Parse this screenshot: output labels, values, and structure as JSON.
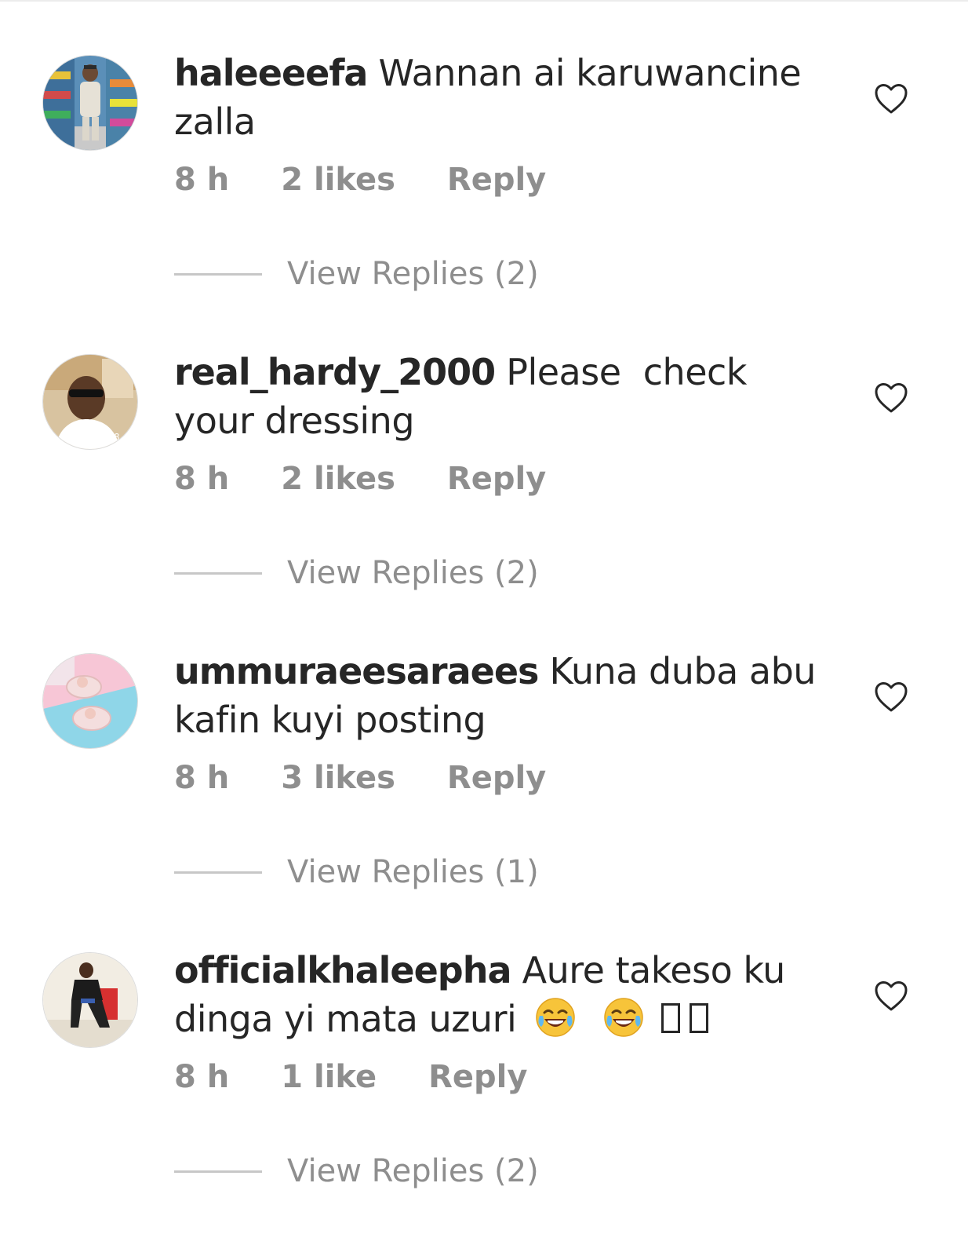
{
  "comments": [
    {
      "username": "haleeeefa",
      "text": "Wannan ai karuwancine zalla",
      "time": "8 h",
      "likes": "2 likes",
      "reply_label": "Reply",
      "view_replies": "View Replies (2)"
    },
    {
      "username": "real_hardy_2000",
      "text": "Please  check your dressing",
      "time": "8 h",
      "likes": "2 likes",
      "reply_label": "Reply",
      "view_replies": "View Replies (2)",
      "avatar_caption": "JUL 7, 2018"
    },
    {
      "username": "ummuraeesaraees",
      "text": "Kuna duba abu kafin kuyi posting",
      "time": "8 h",
      "likes": "3 likes",
      "reply_label": "Reply",
      "view_replies": "View Replies (1)"
    },
    {
      "username": "officialkhaleepha",
      "text": "Aure takeso ku dinga yi mata uzuri",
      "emojis": [
        "face-with-tears-of-joy",
        "face-with-tears-of-joy",
        "missing-glyph",
        "missing-glyph"
      ],
      "time": "8 h",
      "likes": "1 like",
      "reply_label": "Reply",
      "view_replies": "View Replies (2)"
    }
  ],
  "icons": {
    "like": "heart-outline-icon"
  },
  "colors": {
    "primary_text": "#262626",
    "secondary_text": "#8e8e8e",
    "divider": "#c7c7c7"
  }
}
